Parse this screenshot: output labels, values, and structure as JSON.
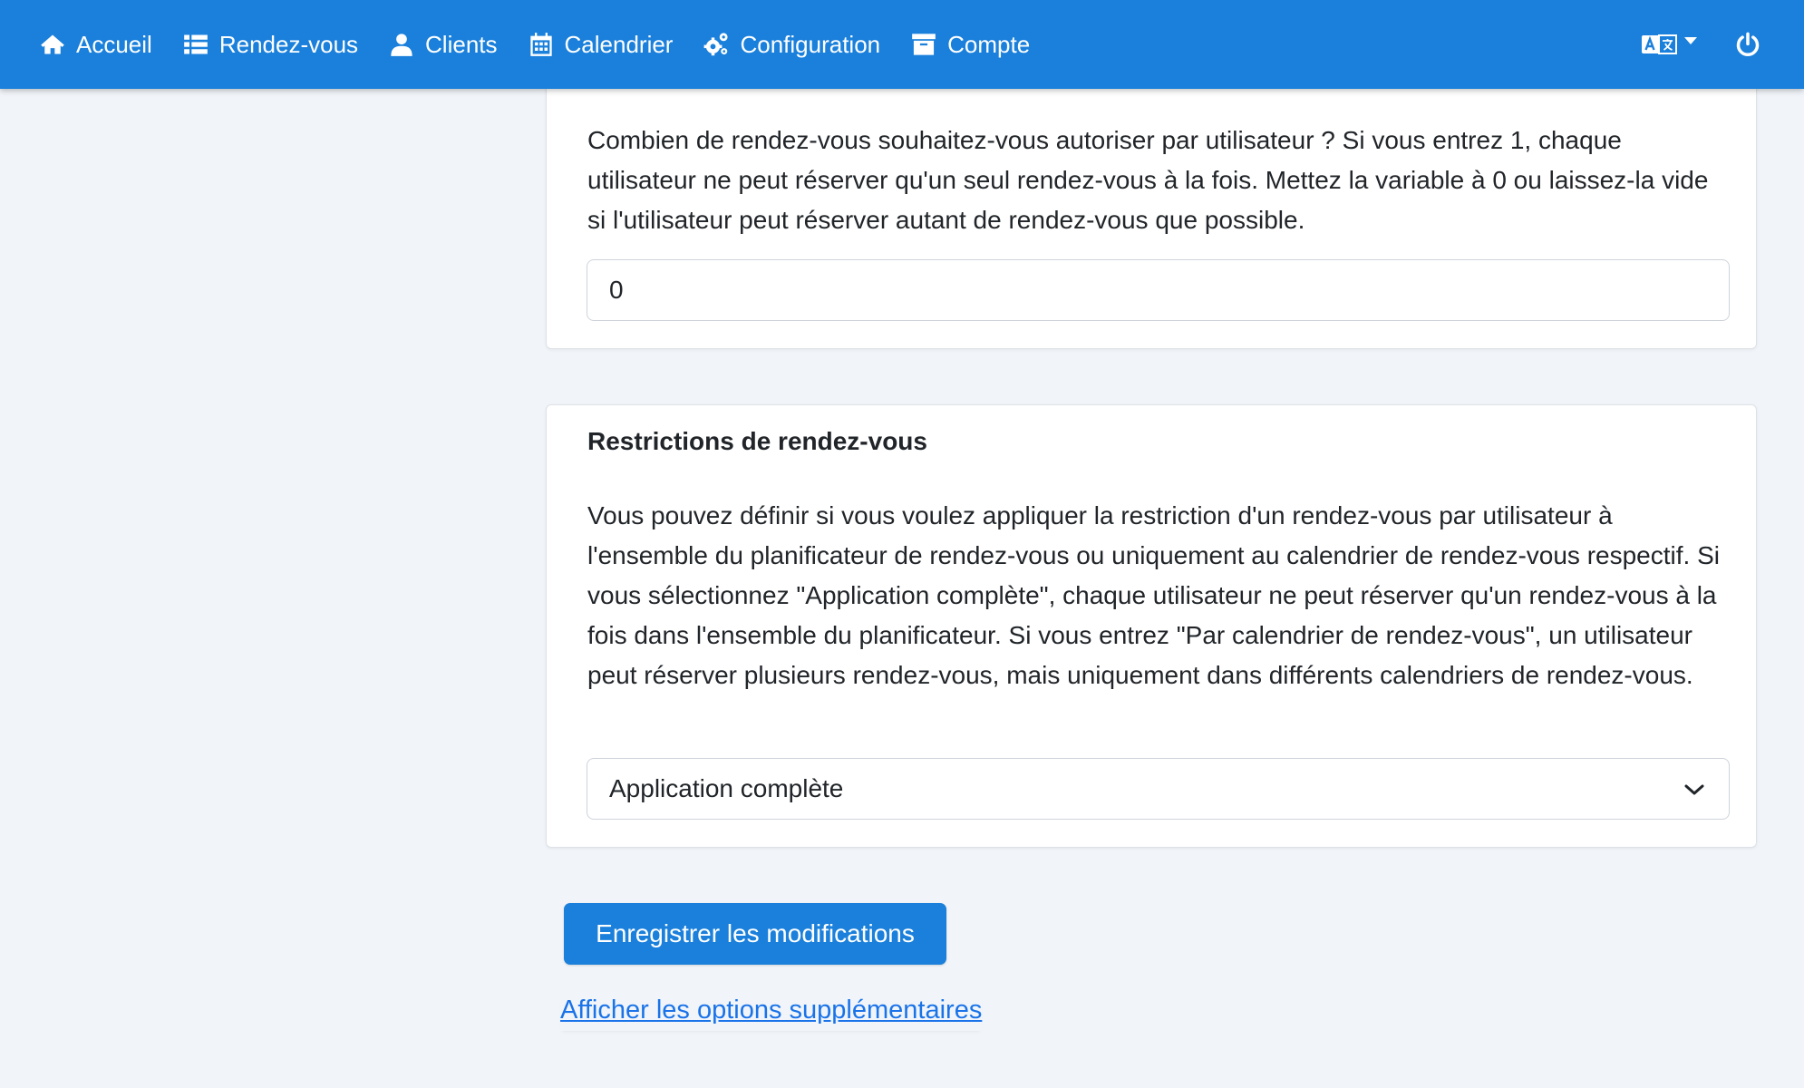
{
  "nav": {
    "items": [
      {
        "label": "Accueil",
        "icon": "home-icon"
      },
      {
        "label": "Rendez-vous",
        "icon": "list-icon"
      },
      {
        "label": "Clients",
        "icon": "user-icon"
      },
      {
        "label": "Calendrier",
        "icon": "calendar-icon"
      },
      {
        "label": "Configuration",
        "icon": "cogs-icon"
      },
      {
        "label": "Compte",
        "icon": "archive-icon"
      }
    ],
    "language_icon": "language-icon",
    "logout_icon": "power-icon"
  },
  "max_appointments": {
    "description": "Combien de rendez-vous souhaitez-vous autoriser par utilisateur ? Si vous entrez 1, chaque utilisateur ne peut réserver qu'un seul rendez-vous à la fois. Mettez la variable à 0 ou laissez-la vide si l'utilisateur peut réserver autant de rendez-vous que possible.",
    "value": "0"
  },
  "restrictions": {
    "title": "Restrictions de rendez-vous",
    "description": "Vous pouvez définir si vous voulez appliquer la restriction d'un rendez-vous par utilisateur à l'ensemble du planificateur de rendez-vous ou uniquement au calendrier de rendez-vous respectif. Si vous sélectionnez \"Application complète\", chaque utilisateur ne peut réserver qu'un rendez-vous à la fois dans l'ensemble du planificateur. Si vous entrez \"Par calendrier de rendez-vous\", un utilisateur peut réserver plusieurs rendez-vous, mais uniquement dans différents calendriers de rendez-vous.",
    "selected": "Application complète"
  },
  "actions": {
    "save_label": "Enregistrer les modifications",
    "more_options_label": "Afficher les options supplémentaires"
  },
  "colors": {
    "primary": "#1a80db",
    "background": "#f1f5f9",
    "link": "#1a73e8"
  }
}
